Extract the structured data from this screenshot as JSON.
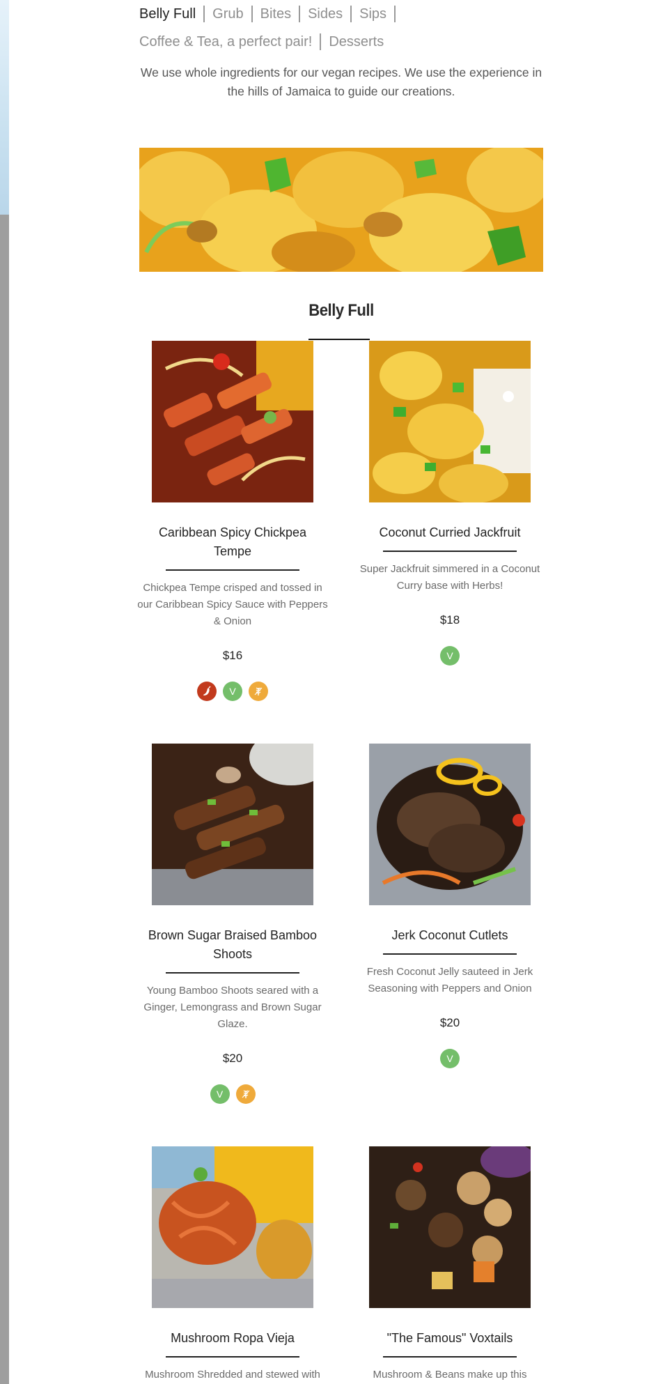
{
  "nav": {
    "row1": [
      "Belly Full",
      "Grub",
      "Bites",
      "Sides",
      "Sips"
    ],
    "row2": [
      "Coffee & Tea, a perfect pair!",
      "Desserts"
    ],
    "active": "Belly Full"
  },
  "intro": "We use whole ingredients for our vegan recipes. We use the experience in the hills of Jamaica to guide our creations.",
  "section": {
    "title": "Belly Full"
  },
  "colors": {
    "spicy": "#c23a1d",
    "vegan": "#74be6a",
    "gluten_free": "#efaa3b"
  },
  "items": [
    {
      "name": "Caribbean Spicy Chickpea Tempe",
      "description": "Chickpea Tempe crisped and tossed in our Caribbean Spicy Sauce with Peppers & Onion",
      "price": "$16",
      "badges": [
        "spicy",
        "vegan",
        "gluten-free"
      ],
      "vegan_label": "V"
    },
    {
      "name": "Coconut Curried Jackfruit",
      "description": "Super Jackfruit simmered in a Coconut Curry base with Herbs!",
      "price": "$18",
      "badges": [
        "vegan"
      ],
      "vegan_label": "V"
    },
    {
      "name": "Brown Sugar Braised Bamboo Shoots",
      "description": "Young Bamboo Shoots seared with a Ginger, Lemongrass and Brown Sugar Glaze.",
      "price": "$20",
      "badges": [
        "vegan",
        "gluten-free"
      ],
      "vegan_label": "V"
    },
    {
      "name": "Jerk Coconut Cutlets",
      "description": "Fresh Coconut Jelly sauteed in Jerk Seasoning with Peppers and Onion",
      "price": "$20",
      "badges": [
        "vegan"
      ],
      "vegan_label": "V"
    },
    {
      "name": "Mushroom Ropa Vieja",
      "description": "Mushroom Shredded and stewed with"
    },
    {
      "name": "\"The Famous\" Voxtails",
      "description": "Mushroom & Beans make up this"
    }
  ]
}
